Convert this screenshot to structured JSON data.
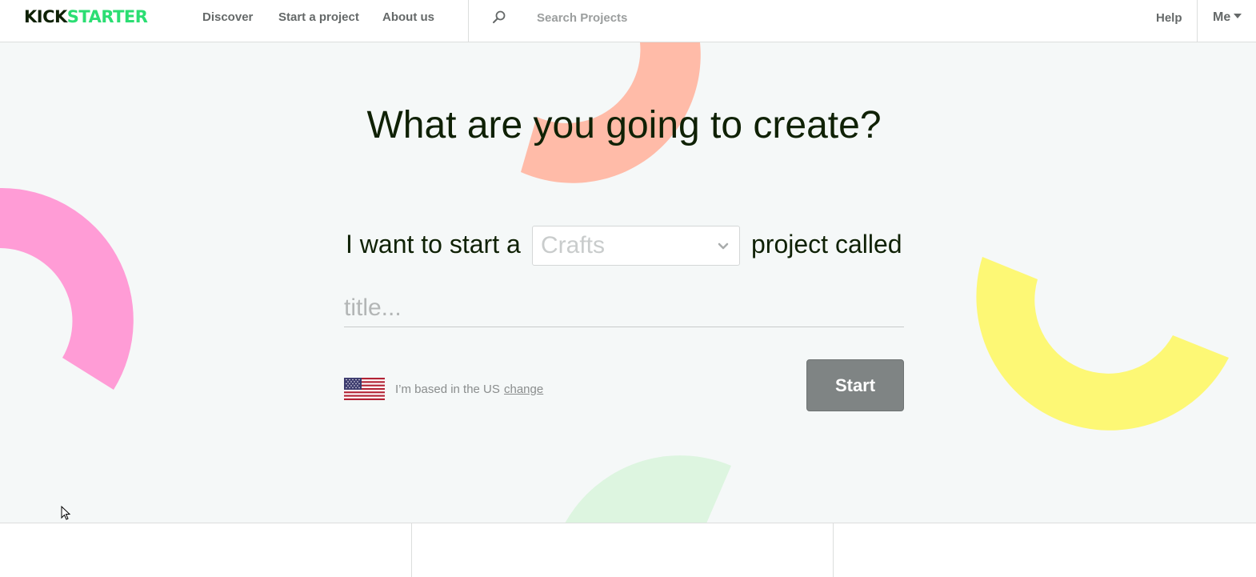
{
  "header": {
    "logo": {
      "part1": "KICK",
      "part2": "STARTER"
    },
    "nav": {
      "discover": "Discover",
      "start_project": "Start a project",
      "about": "About us"
    },
    "search": {
      "placeholder": "Search Projects",
      "icon": "search-icon"
    },
    "help": "Help",
    "me": "Me"
  },
  "hero": {
    "headline": "What are you going to create?",
    "sentence_start": "I want to start a",
    "sentence_end": "project called",
    "category": {
      "selected": "Crafts",
      "icon": "chevron-down-icon"
    },
    "title_placeholder": "title...",
    "location_text": "I’m based in the US",
    "change_link": "change",
    "start_button": "Start"
  },
  "colors": {
    "brand_green": "#2bde73",
    "brand_dark": "#0f2105",
    "hero_background": "#f5f8f8",
    "shape_salmon": "#ffbba8",
    "shape_pink": "#ff9cd6",
    "shape_yellow": "#fdf875",
    "shape_mint": "#ddf5e0",
    "start_button": "#7f8484"
  }
}
